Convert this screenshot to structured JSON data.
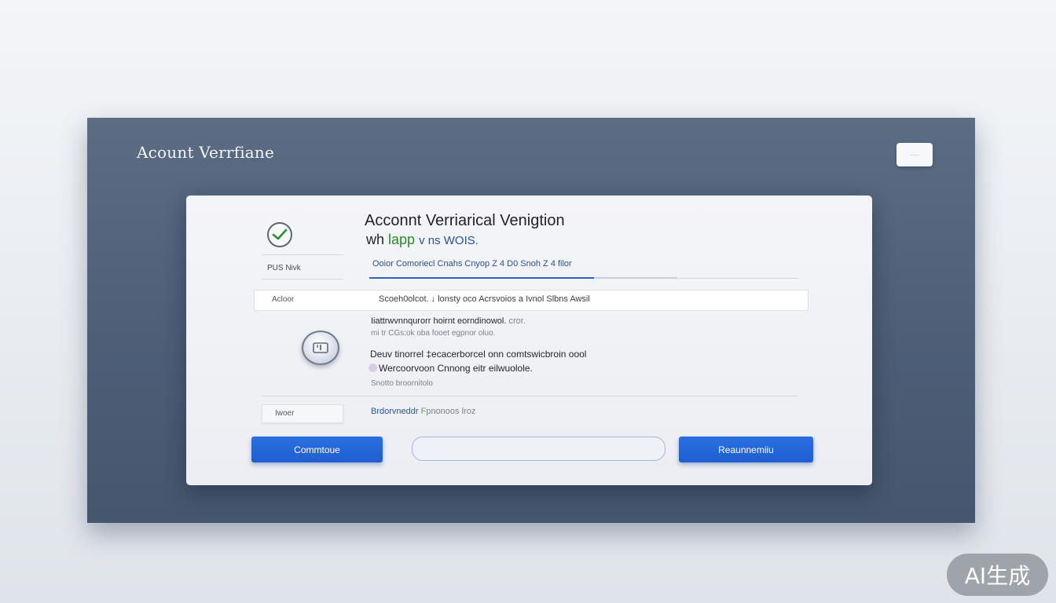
{
  "window": {
    "title": "Acount Verrfiane",
    "chip_label": "........"
  },
  "card": {
    "title": "Acconnt Verriarical Venigtion",
    "subtitle_prefix": "wh",
    "subtitle_green": "lapp",
    "subtitle_blue": "v ns WOIS.",
    "left_label_1": "PUS Nivk",
    "blue_line_text": "Ooior  Comoriecl  Cnahs Cnyop Z 4  D0  Snoh Z  4 filor",
    "progress_fraction": 0.73,
    "field_label": "Acloor",
    "field_value": "Scoeh0olcot.  ↓ lonsty oco  Acrsvoios  a Ivnol  Slbns Awsil",
    "text_line_1": "Iiattrwvnnqurorr hoirnt eorndinowol.",
    "text_line_1_tail": "cror.",
    "text_line_2": "mi tr CGs:ok oba  fooet  egpnor",
    "text_line_2_tail": "oluo.",
    "text_line_3": "Deuv tinorrel ‡ecacerborcel onn comtswicbroin oool",
    "text_line_4": "Wercoorvoon  Cnnong  eitr  eilwuolole.",
    "text_line_5": "Snotto broornitolo",
    "bottom_label": "Iwoer",
    "bottom_text": "Brdorvneddr",
    "bottom_text_tail": "Fpnonoos lroz",
    "buttons": {
      "continue": "Commtoue",
      "middle": "",
      "right": "Reaunnemiiu"
    },
    "icons": {
      "check": "check-icon",
      "shield": "shield-icon"
    }
  },
  "badge": {
    "text": "AI生成"
  },
  "colors": {
    "accent": "#2166d6",
    "panel": "#516179",
    "green": "#2c8a2e"
  }
}
